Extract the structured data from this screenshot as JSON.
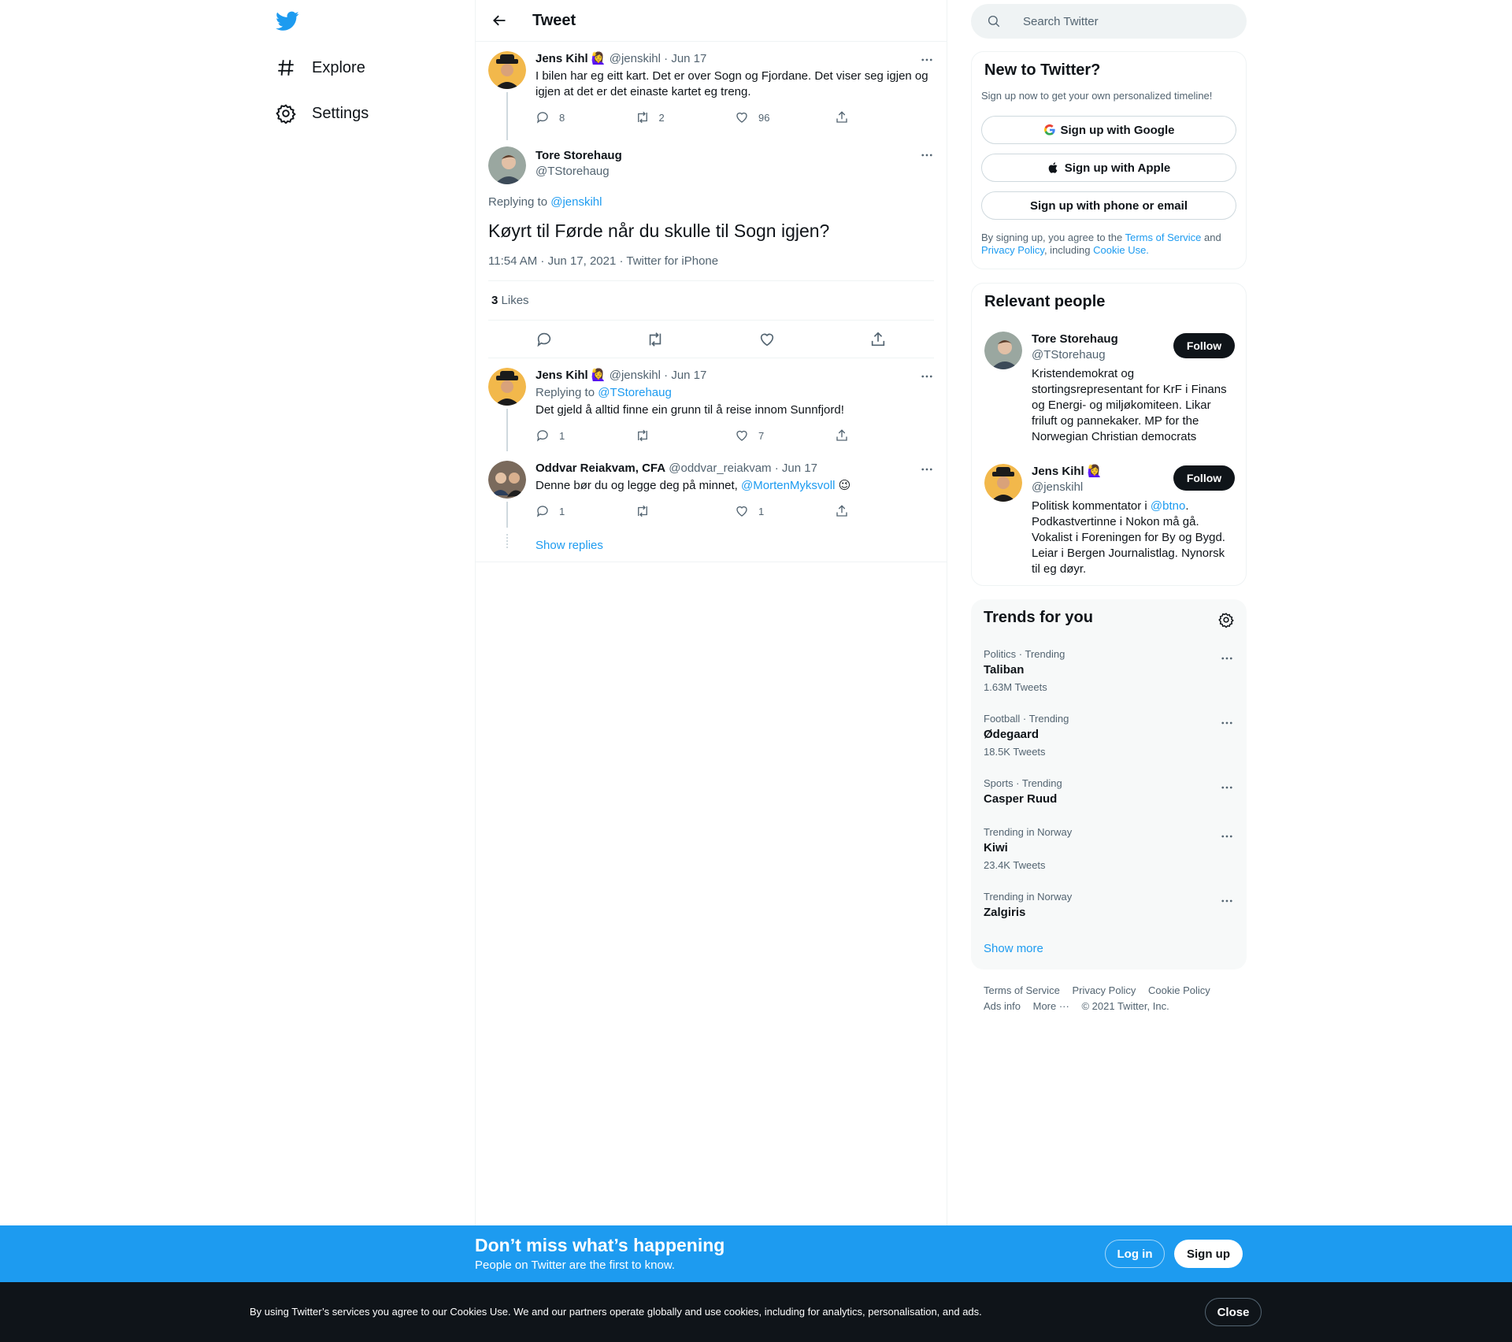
{
  "nav": {
    "explore": "Explore",
    "settings": "Settings"
  },
  "header": {
    "title": "Tweet"
  },
  "tweets": {
    "parent": {
      "name": "Jens Kihl",
      "emoji": "🙋‍♀️",
      "handle": "@jenskihl",
      "date": "· Jun 17",
      "text": "I bilen har eg eitt kart. Det er over Sogn og Fjordane. Det viser seg igjen og igjen at det er det einaste kartet eg treng.",
      "replies": "8",
      "retweets": "2",
      "likes": "96"
    },
    "main": {
      "name": "Tore Storehaug",
      "handle": "@TStorehaug",
      "replying_prefix": "Replying to ",
      "replying_to": "@jenskihl",
      "text": "Køyrt til Førde når du skulle til Sogn igjen?",
      "timestamp": "11:54 AM · Jun 17, 2021 · Twitter for iPhone",
      "likes_count": "3",
      "likes_label": "Likes"
    },
    "reply1": {
      "name": "Jens Kihl",
      "emoji": "🙋‍♀️",
      "handle": "@jenskihl",
      "date": "· Jun 17",
      "replying_prefix": "Replying to ",
      "replying_to": "@TStorehaug",
      "text": "Det gjeld å alltid finne ein grunn til å reise innom Sunnfjord!",
      "replies": "1",
      "retweets": "",
      "likes": "7"
    },
    "reply2": {
      "name": "Oddvar Reiakvam, CFA",
      "handle": "@oddvar_reiakvam",
      "date": "· Jun 17",
      "text": "Denne bør du og legge deg på minnet, ",
      "mention": "@MortenMyksvoll",
      "emoji": "😉",
      "replies": "1",
      "retweets": "",
      "likes": "1"
    },
    "show_replies": "Show replies"
  },
  "search": {
    "placeholder": "Search Twitter"
  },
  "new_to_twitter": {
    "title": "New to Twitter?",
    "subtitle": "Sign up now to get your own personalized timeline!",
    "google": "Sign up with Google",
    "apple": "Sign up with Apple",
    "phone": "Sign up with phone or email",
    "legal_1": "By signing up, you agree to the ",
    "tos": "Terms of Service",
    "legal_2": " and ",
    "privacy": "Privacy Policy",
    "legal_3": ", including ",
    "cookie": "Cookie Use."
  },
  "relevant_people": {
    "title": "Relevant people",
    "people": [
      {
        "name": "Tore Storehaug",
        "emoji": "",
        "handle": "@TStorehaug",
        "bio": "Kristendemokrat og stortingsrepresentant for KrF i Finans og Energi- og miljøkomiteen. Likar friluft og pannekaker. MP for the Norwegian Christian democrats",
        "follow": "Follow"
      },
      {
        "name": "Jens Kihl",
        "emoji": "🙋‍♀️",
        "handle": "@jenskihl",
        "bio_1": "Politisk kommentator i ",
        "bio_mention": "@btno",
        "bio_2": ". Podkastvertinne i Nokon må gå. Vokalist i Foreningen for By og Bygd. Leiar i Bergen Journalistlag. Nynorsk til eg døyr.",
        "follow": "Follow"
      }
    ]
  },
  "trends": {
    "title": "Trends for you",
    "items": [
      {
        "category": "Politics · Trending",
        "name": "Taliban",
        "count": "1.63M Tweets"
      },
      {
        "category": "Football · Trending",
        "name": "Ødegaard",
        "count": "18.5K Tweets"
      },
      {
        "category": "Sports · Trending",
        "name": "Casper Ruud",
        "count": ""
      },
      {
        "category": "Trending in Norway",
        "name": "Kiwi",
        "count": "23.4K Tweets"
      },
      {
        "category": "Trending in Norway",
        "name": "Zalgiris",
        "count": ""
      }
    ],
    "show_more": "Show more"
  },
  "footer": {
    "tos": "Terms of Service",
    "privacy": "Privacy Policy",
    "cookie": "Cookie Policy",
    "ads": "Ads info",
    "more": "More ···",
    "copyright": "© 2021 Twitter, Inc."
  },
  "signup_bar": {
    "headline": "Don’t miss what’s happening",
    "subline": "People on Twitter are the first to know.",
    "login": "Log in",
    "signup": "Sign up"
  },
  "cookie_bar": {
    "text": "By using Twitter’s services you agree to our Cookies Use. We and our partners operate globally and use cookies, including for analytics, personalisation, and ads.",
    "close": "Close"
  },
  "colors": {
    "accent": "#1d9bf0",
    "text": "#0f1419",
    "muted": "#536471"
  }
}
